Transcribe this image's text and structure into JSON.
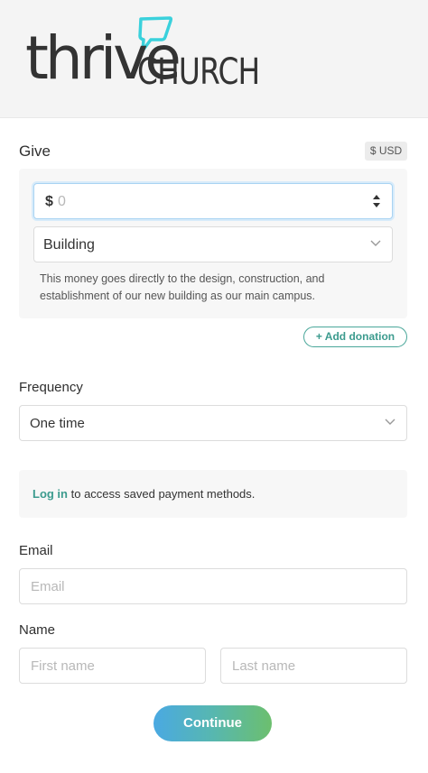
{
  "brand": {
    "logo_word": "thrive",
    "logo_suffix": "CHURCH",
    "leaf_color": "#3ad1dc",
    "accent": "#3c9b8e"
  },
  "give": {
    "title": "Give",
    "currency": "$ USD",
    "amount_symbol": "$",
    "amount_placeholder": "0",
    "fund_selected": "Building",
    "fund_description": "This money goes directly to the design, construction, and establishment of our new building as our main campus.",
    "add_donation_label": "+ Add donation"
  },
  "frequency": {
    "label": "Frequency",
    "selected": "One time"
  },
  "login": {
    "link_text": "Log in",
    "rest_text": " to access saved payment methods."
  },
  "email": {
    "label": "Email",
    "placeholder": "Email"
  },
  "name": {
    "label": "Name",
    "first_placeholder": "First name",
    "last_placeholder": "Last name"
  },
  "continue_label": "Continue"
}
